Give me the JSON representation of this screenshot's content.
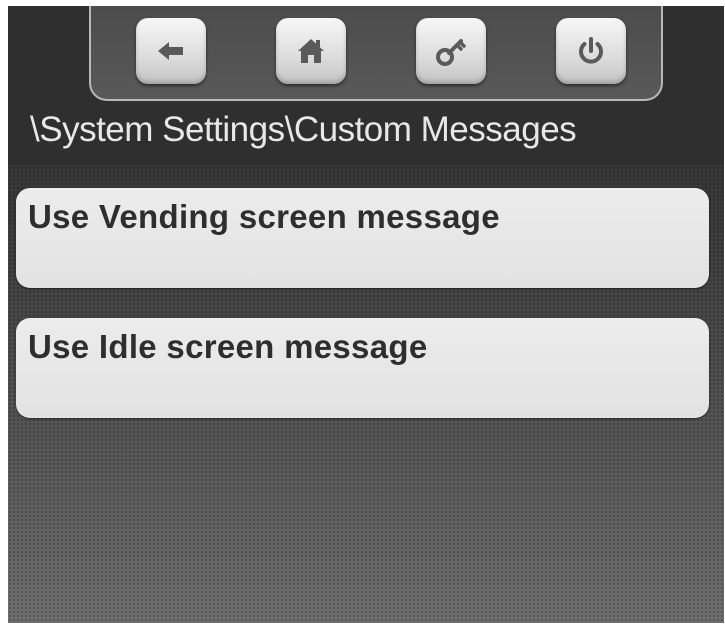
{
  "toolbar": {
    "buttons": [
      {
        "icon": "back-arrow-icon"
      },
      {
        "icon": "home-icon"
      },
      {
        "icon": "key-icon"
      },
      {
        "icon": "power-icon"
      }
    ]
  },
  "breadcrumb": {
    "path": "\\System Settings\\Custom Messages"
  },
  "menu": {
    "items": [
      {
        "label": "Use Vending screen message"
      },
      {
        "label": "Use Idle screen message"
      }
    ]
  },
  "colors": {
    "header_bg": "#2f2f2f",
    "item_bg": "#e6e6e6",
    "item_text": "#2e2e2e",
    "breadcrumb_text": "#e8e8e8"
  }
}
